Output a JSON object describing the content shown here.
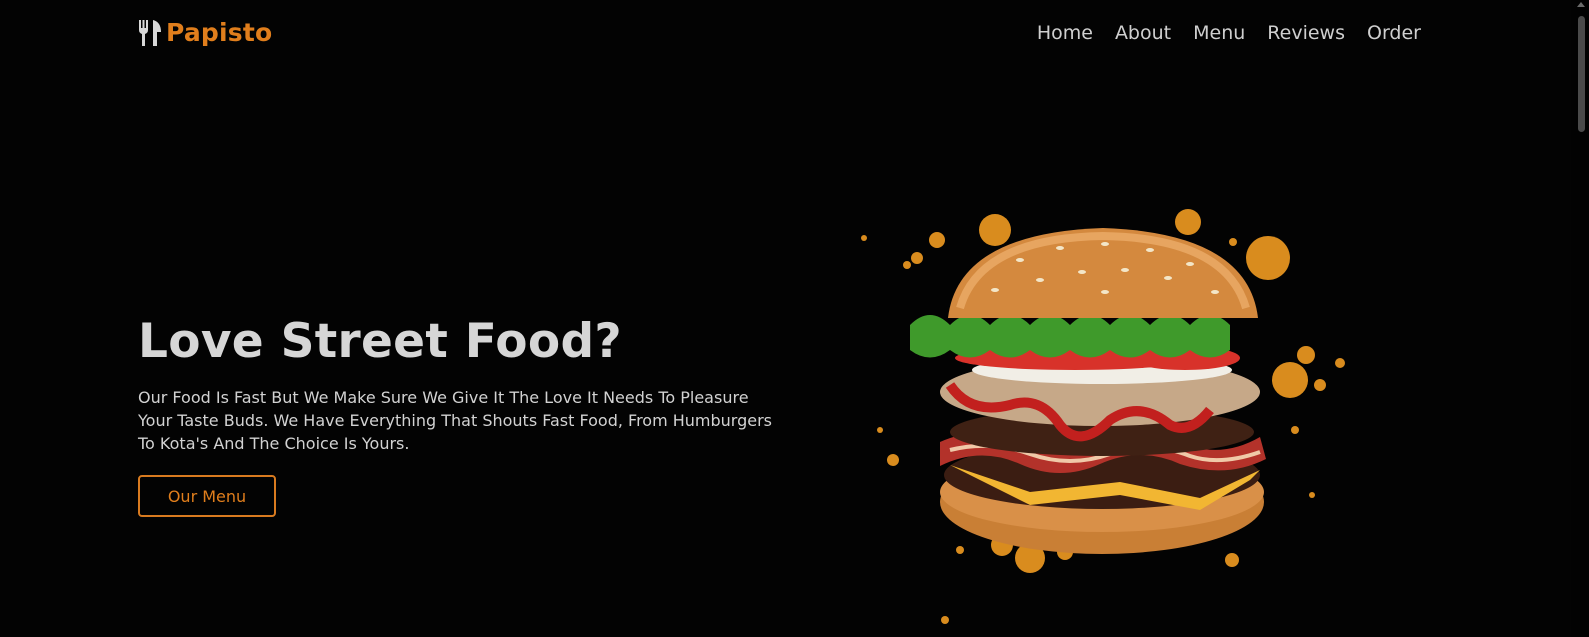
{
  "brand": {
    "name": "Papisto",
    "icon": "utensils-icon",
    "color": "#e07e1c"
  },
  "nav": {
    "items": [
      {
        "label": "Home"
      },
      {
        "label": "About"
      },
      {
        "label": "Menu"
      },
      {
        "label": "Reviews"
      },
      {
        "label": "Order"
      }
    ]
  },
  "hero": {
    "title": "Love Street Food?",
    "text": "Our Food Is Fast But We Make Sure We Give It The Love It Needs To Pleasure Your Taste Buds. We Have Everything That Shouts Fast Food, From Humburgers To Kota's And The Choice Is Yours.",
    "button_label": "Our Menu",
    "image": "burger-image"
  },
  "colors": {
    "accent": "#e07e1c",
    "background": "#030303",
    "text": "#d2d2d2"
  }
}
